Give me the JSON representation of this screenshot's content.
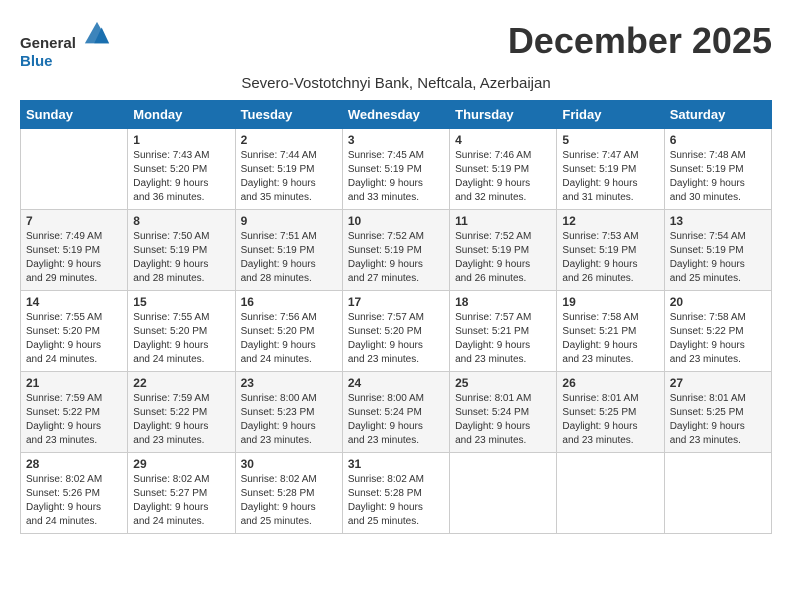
{
  "header": {
    "logo_general": "General",
    "logo_blue": "Blue",
    "month_title": "December 2025",
    "subtitle": "Severo-Vostotchnyi Bank, Neftcala, Azerbaijan"
  },
  "weekdays": [
    "Sunday",
    "Monday",
    "Tuesday",
    "Wednesday",
    "Thursday",
    "Friday",
    "Saturday"
  ],
  "weeks": [
    [
      {
        "day": "",
        "info": ""
      },
      {
        "day": "1",
        "info": "Sunrise: 7:43 AM\nSunset: 5:20 PM\nDaylight: 9 hours\nand 36 minutes."
      },
      {
        "day": "2",
        "info": "Sunrise: 7:44 AM\nSunset: 5:19 PM\nDaylight: 9 hours\nand 35 minutes."
      },
      {
        "day": "3",
        "info": "Sunrise: 7:45 AM\nSunset: 5:19 PM\nDaylight: 9 hours\nand 33 minutes."
      },
      {
        "day": "4",
        "info": "Sunrise: 7:46 AM\nSunset: 5:19 PM\nDaylight: 9 hours\nand 32 minutes."
      },
      {
        "day": "5",
        "info": "Sunrise: 7:47 AM\nSunset: 5:19 PM\nDaylight: 9 hours\nand 31 minutes."
      },
      {
        "day": "6",
        "info": "Sunrise: 7:48 AM\nSunset: 5:19 PM\nDaylight: 9 hours\nand 30 minutes."
      }
    ],
    [
      {
        "day": "7",
        "info": "Sunrise: 7:49 AM\nSunset: 5:19 PM\nDaylight: 9 hours\nand 29 minutes."
      },
      {
        "day": "8",
        "info": "Sunrise: 7:50 AM\nSunset: 5:19 PM\nDaylight: 9 hours\nand 28 minutes."
      },
      {
        "day": "9",
        "info": "Sunrise: 7:51 AM\nSunset: 5:19 PM\nDaylight: 9 hours\nand 28 minutes."
      },
      {
        "day": "10",
        "info": "Sunrise: 7:52 AM\nSunset: 5:19 PM\nDaylight: 9 hours\nand 27 minutes."
      },
      {
        "day": "11",
        "info": "Sunrise: 7:52 AM\nSunset: 5:19 PM\nDaylight: 9 hours\nand 26 minutes."
      },
      {
        "day": "12",
        "info": "Sunrise: 7:53 AM\nSunset: 5:19 PM\nDaylight: 9 hours\nand 26 minutes."
      },
      {
        "day": "13",
        "info": "Sunrise: 7:54 AM\nSunset: 5:19 PM\nDaylight: 9 hours\nand 25 minutes."
      }
    ],
    [
      {
        "day": "14",
        "info": "Sunrise: 7:55 AM\nSunset: 5:20 PM\nDaylight: 9 hours\nand 24 minutes."
      },
      {
        "day": "15",
        "info": "Sunrise: 7:55 AM\nSunset: 5:20 PM\nDaylight: 9 hours\nand 24 minutes."
      },
      {
        "day": "16",
        "info": "Sunrise: 7:56 AM\nSunset: 5:20 PM\nDaylight: 9 hours\nand 24 minutes."
      },
      {
        "day": "17",
        "info": "Sunrise: 7:57 AM\nSunset: 5:20 PM\nDaylight: 9 hours\nand 23 minutes."
      },
      {
        "day": "18",
        "info": "Sunrise: 7:57 AM\nSunset: 5:21 PM\nDaylight: 9 hours\nand 23 minutes."
      },
      {
        "day": "19",
        "info": "Sunrise: 7:58 AM\nSunset: 5:21 PM\nDaylight: 9 hours\nand 23 minutes."
      },
      {
        "day": "20",
        "info": "Sunrise: 7:58 AM\nSunset: 5:22 PM\nDaylight: 9 hours\nand 23 minutes."
      }
    ],
    [
      {
        "day": "21",
        "info": "Sunrise: 7:59 AM\nSunset: 5:22 PM\nDaylight: 9 hours\nand 23 minutes."
      },
      {
        "day": "22",
        "info": "Sunrise: 7:59 AM\nSunset: 5:22 PM\nDaylight: 9 hours\nand 23 minutes."
      },
      {
        "day": "23",
        "info": "Sunrise: 8:00 AM\nSunset: 5:23 PM\nDaylight: 9 hours\nand 23 minutes."
      },
      {
        "day": "24",
        "info": "Sunrise: 8:00 AM\nSunset: 5:24 PM\nDaylight: 9 hours\nand 23 minutes."
      },
      {
        "day": "25",
        "info": "Sunrise: 8:01 AM\nSunset: 5:24 PM\nDaylight: 9 hours\nand 23 minutes."
      },
      {
        "day": "26",
        "info": "Sunrise: 8:01 AM\nSunset: 5:25 PM\nDaylight: 9 hours\nand 23 minutes."
      },
      {
        "day": "27",
        "info": "Sunrise: 8:01 AM\nSunset: 5:25 PM\nDaylight: 9 hours\nand 23 minutes."
      }
    ],
    [
      {
        "day": "28",
        "info": "Sunrise: 8:02 AM\nSunset: 5:26 PM\nDaylight: 9 hours\nand 24 minutes."
      },
      {
        "day": "29",
        "info": "Sunrise: 8:02 AM\nSunset: 5:27 PM\nDaylight: 9 hours\nand 24 minutes."
      },
      {
        "day": "30",
        "info": "Sunrise: 8:02 AM\nSunset: 5:28 PM\nDaylight: 9 hours\nand 25 minutes."
      },
      {
        "day": "31",
        "info": "Sunrise: 8:02 AM\nSunset: 5:28 PM\nDaylight: 9 hours\nand 25 minutes."
      },
      {
        "day": "",
        "info": ""
      },
      {
        "day": "",
        "info": ""
      },
      {
        "day": "",
        "info": ""
      }
    ]
  ]
}
